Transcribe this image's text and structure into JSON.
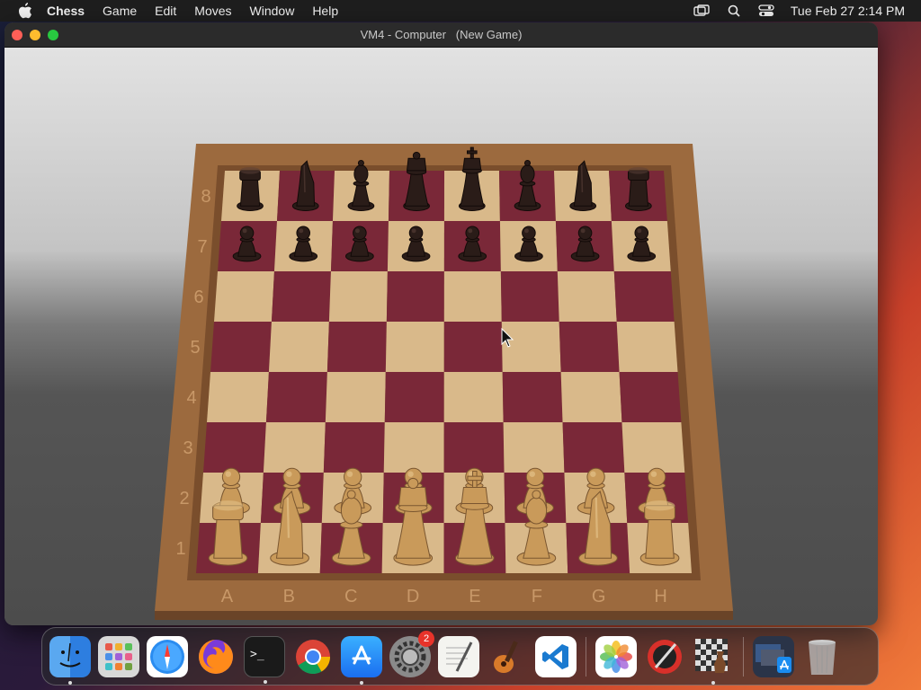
{
  "menubar": {
    "app_name": "Chess",
    "items": [
      "Game",
      "Edit",
      "Moves",
      "Window",
      "Help"
    ],
    "clock": "Tue Feb 27  2:14 PM",
    "status_icons": [
      "screen-mirror-icon",
      "search-icon",
      "control-center-icon"
    ]
  },
  "window": {
    "title": "VM4 - Computer   (New Game)"
  },
  "board": {
    "files": [
      "A",
      "B",
      "C",
      "D",
      "E",
      "F",
      "G",
      "H"
    ],
    "ranks": [
      "1",
      "2",
      "3",
      "4",
      "5",
      "6",
      "7",
      "8"
    ],
    "colors": {
      "light_square": "#d9b98a",
      "dark_square": "#7a2838",
      "frame": "#9c6a3e",
      "white_piece": "#c99a5a",
      "black_piece": "#2a1c18"
    },
    "position": {
      "8": [
        "rook",
        "knight",
        "bishop",
        "queen",
        "king",
        "bishop",
        "knight",
        "rook"
      ],
      "7": [
        "pawn",
        "pawn",
        "pawn",
        "pawn",
        "pawn",
        "pawn",
        "pawn",
        "pawn"
      ],
      "2": [
        "pawn",
        "pawn",
        "pawn",
        "pawn",
        "pawn",
        "pawn",
        "pawn",
        "pawn"
      ],
      "1": [
        "rook",
        "knight",
        "bishop",
        "queen",
        "king",
        "bishop",
        "knight",
        "rook"
      ]
    }
  },
  "dock": {
    "apps": [
      {
        "name": "finder-icon",
        "running": true
      },
      {
        "name": "launchpad-icon",
        "running": false
      },
      {
        "name": "safari-icon",
        "running": false
      },
      {
        "name": "firefox-icon",
        "running": false
      },
      {
        "name": "terminal-icon",
        "running": true
      },
      {
        "name": "chrome-icon",
        "running": false
      },
      {
        "name": "app-store-icon",
        "running": true
      },
      {
        "name": "system-settings-icon",
        "running": false,
        "badge": "2"
      },
      {
        "name": "textedit-icon",
        "running": false
      },
      {
        "name": "garageband-icon",
        "running": false
      },
      {
        "name": "vscode-icon",
        "running": false
      }
    ],
    "recent": [
      {
        "name": "photos-icon",
        "running": false
      },
      {
        "name": "instruments-icon",
        "running": false
      },
      {
        "name": "chess-icon",
        "running": true
      }
    ],
    "trailing": [
      {
        "name": "downloads-stack-icon"
      },
      {
        "name": "trash-icon"
      }
    ]
  }
}
